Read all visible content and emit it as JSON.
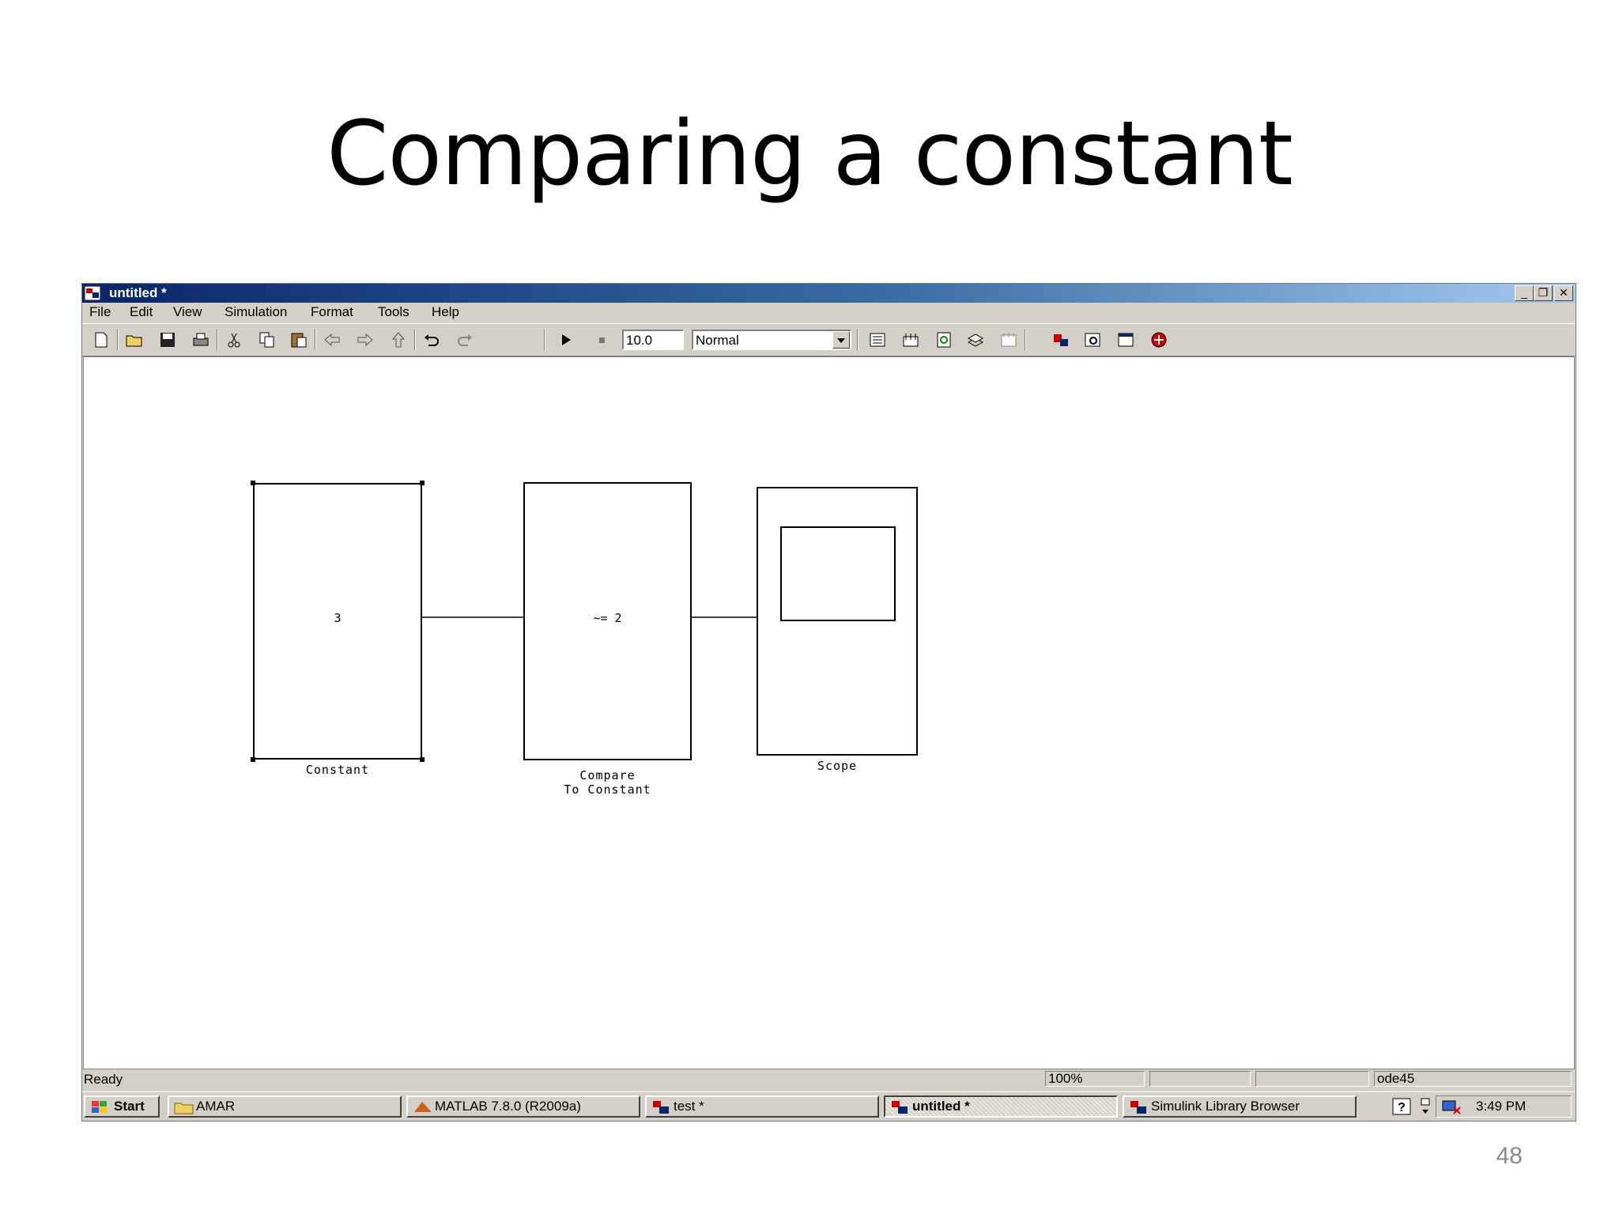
{
  "slide": {
    "title": "Comparing a constant",
    "page_number": "48"
  },
  "window": {
    "title": "untitled *",
    "controls": {
      "minimize": "_",
      "restore": "❐",
      "close": "✕"
    }
  },
  "menu": [
    "File",
    "Edit",
    "View",
    "Simulation",
    "Format",
    "Tools",
    "Help"
  ],
  "toolbar": {
    "stop_time": "10.0",
    "sim_mode": "Normal",
    "icons": [
      "new-icon",
      "open-icon",
      "save-icon",
      "print-icon",
      "cut-icon",
      "copy-icon",
      "paste-icon",
      "back-icon",
      "forward-icon",
      "up-icon",
      "undo-icon",
      "redo-icon",
      "play-icon",
      "stop-icon",
      "build-icon",
      "update-icon",
      "refresh-icon",
      "library-icon",
      "model-explorer-icon",
      "debug-icon",
      "browser-icon",
      "properties-icon",
      "advisor-icon"
    ]
  },
  "blocks": {
    "constant": {
      "value": "3",
      "label": "Constant"
    },
    "compare": {
      "expr": "~= 2",
      "label_line1": "Compare",
      "label_line2": "To Constant"
    },
    "scope": {
      "label": "Scope"
    }
  },
  "statusbar": {
    "status": "Ready",
    "zoom": "100%",
    "solver": "ode45"
  },
  "taskbar": {
    "start": "Start",
    "tasks": [
      {
        "label": "AMAR",
        "icon": "folder-icon"
      },
      {
        "label": "MATLAB  7.8.0 (R2009a)",
        "icon": "matlab-icon"
      },
      {
        "label": "test *",
        "icon": "simulink-icon"
      },
      {
        "label": "untitled *",
        "icon": "simulink-icon",
        "active": true
      },
      {
        "label": "Simulink Library Browser",
        "icon": "simulink-icon"
      }
    ],
    "clock": "3:49 PM"
  },
  "colors": {
    "titlebar_start": "#0a246a",
    "titlebar_end": "#a6caf0",
    "chrome": "#d4d0c8"
  }
}
